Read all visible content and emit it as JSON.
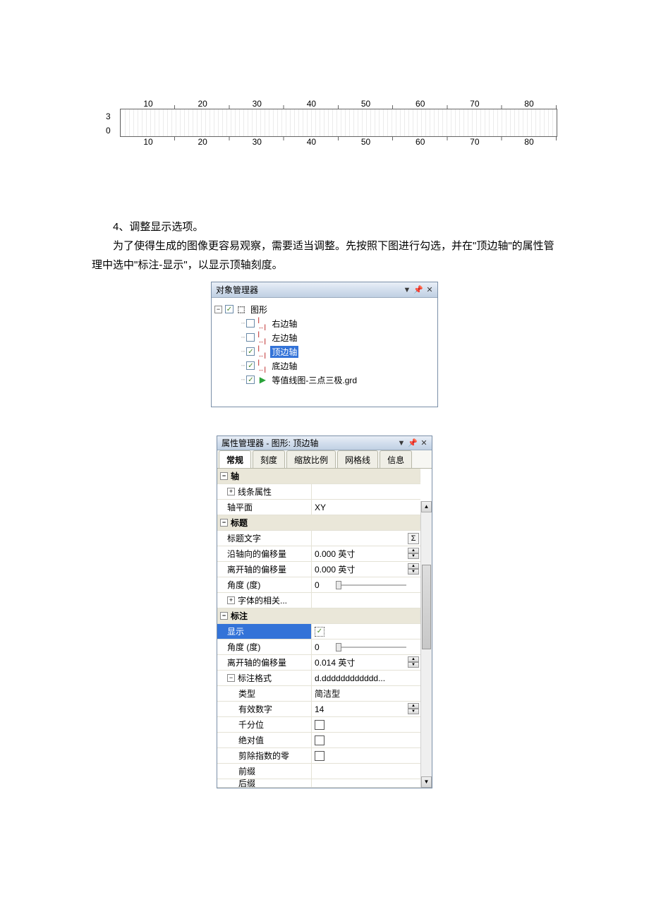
{
  "chart_data": {
    "type": "area",
    "categories": [
      10,
      20,
      30,
      40,
      50,
      60,
      70,
      80
    ],
    "y_ticks": [
      0,
      3
    ],
    "xlabel": "",
    "ylabel": "",
    "top_axis_visible": true,
    "bottom_axis_visible": true
  },
  "text": {
    "step_label": "4、调整显示选项。",
    "para": "为了使得生成的图像更容易观察，需要适当调整。先按照下图进行勾选，并在\"顶边轴\"的属性管理中选中\"标注-显示\"，以显示顶轴刻度。"
  },
  "object_manager": {
    "title": "对象管理器",
    "root": {
      "label": "图形",
      "checked": true
    },
    "items": [
      {
        "label": "右边轴",
        "checked": false
      },
      {
        "label": "左边轴",
        "checked": false
      },
      {
        "label": "顶边轴",
        "checked": true,
        "selected": true
      },
      {
        "label": "底边轴",
        "checked": true
      },
      {
        "label": "等值线图-三点三极.grd",
        "checked": true,
        "icon": "grid"
      }
    ]
  },
  "property_manager": {
    "title": "属性管理器 - 图形: 顶边轴",
    "tabs": [
      "常规",
      "刻度",
      "缩放比例",
      "网格线",
      "信息"
    ],
    "active_tab": 0,
    "sections": {
      "axis": {
        "header": "轴",
        "line_attr": "线条属性",
        "plane_label": "轴平面",
        "plane_value": "XY"
      },
      "title": {
        "header": "标题",
        "text_label": "标题文字",
        "text_value": "",
        "offset_along_label": "沿轴向的偏移量",
        "offset_along_value": "0.000 英寸",
        "offset_away_label": "离开轴的偏移量",
        "offset_away_value": "0.000 英寸",
        "angle_label": "角度 (度)",
        "angle_value": "0",
        "font_label": "字体的相关..."
      },
      "label": {
        "header": "标注",
        "show_label": "显示",
        "show_value": true,
        "angle_label": "角度 (度)",
        "angle_value": "0",
        "offset_label": "离开轴的偏移量",
        "offset_value": "0.014 英寸",
        "format_header": "标注格式",
        "format_preview": "d.dddddddddddd...",
        "type_label": "类型",
        "type_value": "简洁型",
        "digits_label": "有效数字",
        "digits_value": "14",
        "thousands_label": "千分位",
        "thousands_value": false,
        "abs_label": "绝对值",
        "abs_value": false,
        "trim_label": "剪除指数的零",
        "trim_value": false,
        "prefix_label": "前缀",
        "suffix_label": "后缀"
      }
    }
  }
}
